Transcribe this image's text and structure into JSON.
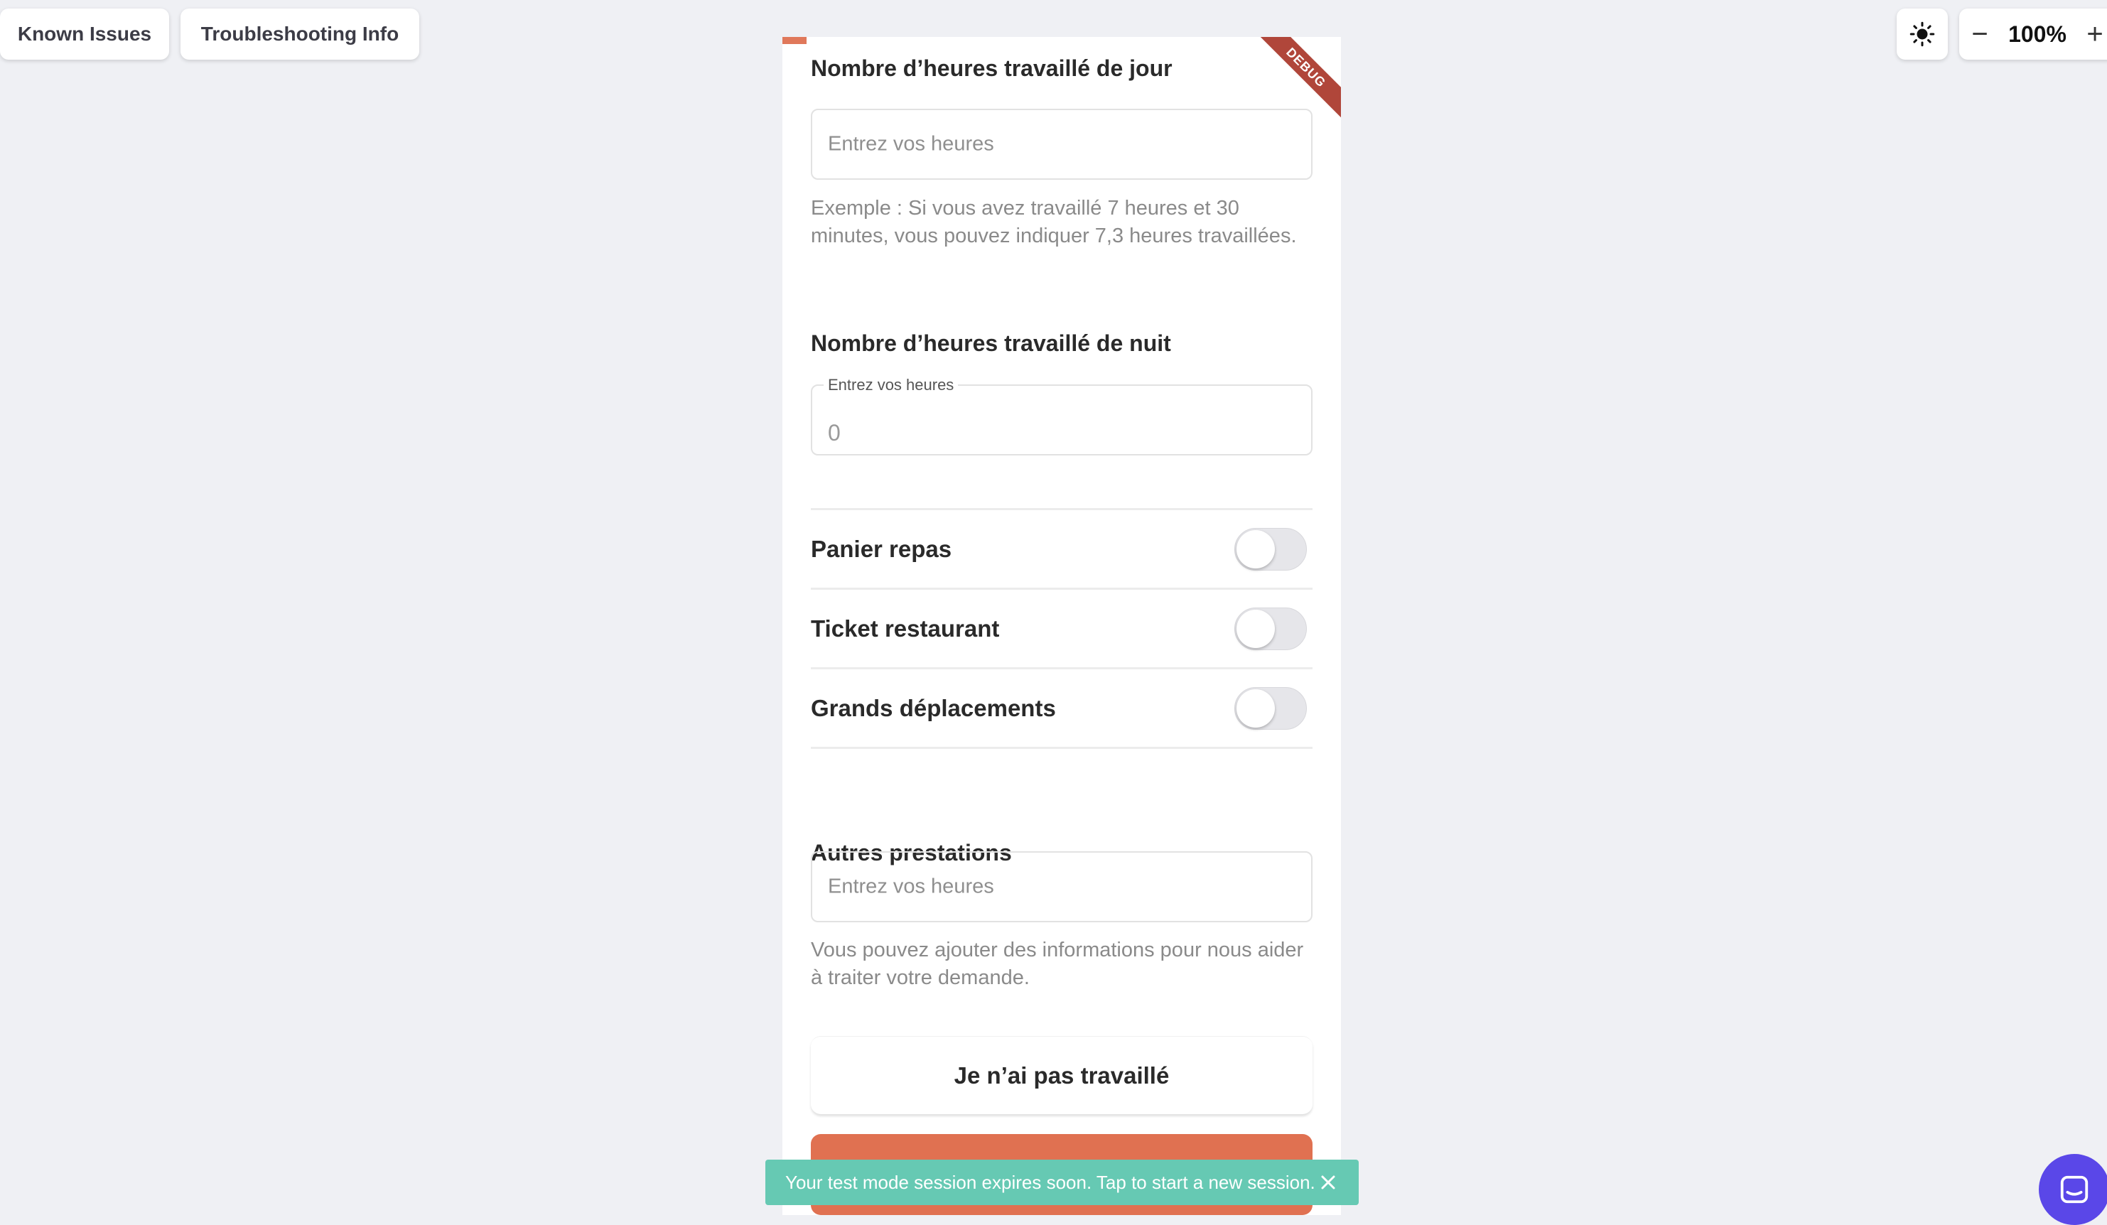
{
  "toolbar": {
    "known_issues": "Known Issues",
    "troubleshooting": "Troubleshooting Info",
    "theme_icon": "sun-icon",
    "zoom_out": "−",
    "zoom_level": "100%",
    "zoom_in": "+"
  },
  "app": {
    "debug_banner": "DEBUG",
    "day_hours": {
      "title": "Nombre d’heures travaillé de jour",
      "placeholder": "Entrez vos heures",
      "helper": "Exemple : Si vous avez travaillé 7 heures et 30 minutes, vous pouvez indiquer 7,3 heures travaillées."
    },
    "night_hours": {
      "title": "Nombre d’heures travaillé de nuit",
      "label": "Entrez vos heures",
      "value": "0"
    },
    "toggles": [
      {
        "label": "Panier repas",
        "on": false
      },
      {
        "label": "Ticket restaurant",
        "on": false
      },
      {
        "label": "Grands déplacements",
        "on": false
      }
    ],
    "other_services": {
      "title": "Autres prestations",
      "placeholder": "Entrez vos heures",
      "helper": "Vous pouvez ajouter des informations pour nous aider à traiter votre demande."
    },
    "not_worked_button": "Je n’ai pas travaillé"
  },
  "toast": {
    "message": "Your test mode session expires soon. Tap to start a new session.",
    "close_icon": "close-icon"
  },
  "colors": {
    "accent": "#e07151",
    "toast": "#66c9b3",
    "launcher": "#5a47e8",
    "debug": "#b0463a"
  }
}
